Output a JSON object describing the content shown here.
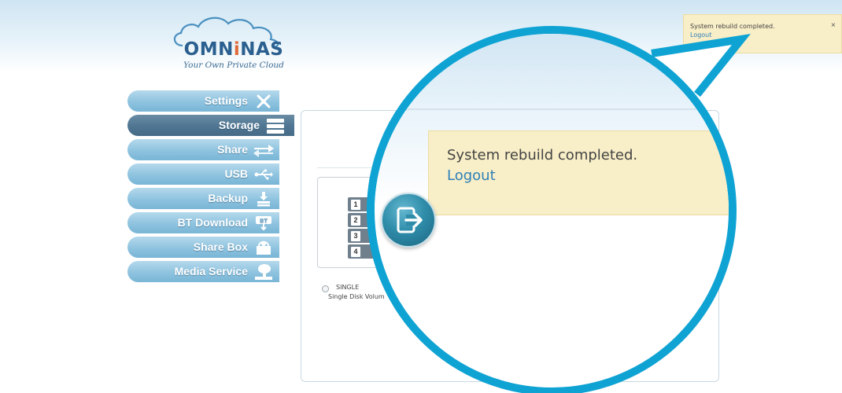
{
  "brand": {
    "name_part1": "OMN",
    "name_accent": "i",
    "name_part2": "NAS",
    "tagline": "Your Own Private Cloud"
  },
  "sidebar": {
    "items": [
      {
        "label": "Settings",
        "icon": "tools-icon"
      },
      {
        "label": "Storage",
        "icon": "storage-stack-icon",
        "active": true
      },
      {
        "label": "Share",
        "icon": "share-arrows-icon"
      },
      {
        "label": "USB",
        "icon": "usb-icon"
      },
      {
        "label": "Backup",
        "icon": "backup-download-icon"
      },
      {
        "label": "BT Download",
        "icon": "bt-download-icon"
      },
      {
        "label": "Share Box",
        "icon": "share-box-icon"
      },
      {
        "label": "Media Service",
        "icon": "media-service-icon"
      }
    ]
  },
  "storage": {
    "disks": [
      "1",
      "2",
      "3",
      "4"
    ],
    "option_label": "SINGLE",
    "option_description": "Single Disk Volum"
  },
  "notification": {
    "message": "System rebuild completed.",
    "logout": "Logout",
    "close": "×"
  },
  "colors": {
    "accent": "#0fa3d3",
    "notice_bg": "#f8eec7",
    "link": "#2e7fb8",
    "nav_active": "#4f7592",
    "nav_inactive": "#8ec3df"
  }
}
